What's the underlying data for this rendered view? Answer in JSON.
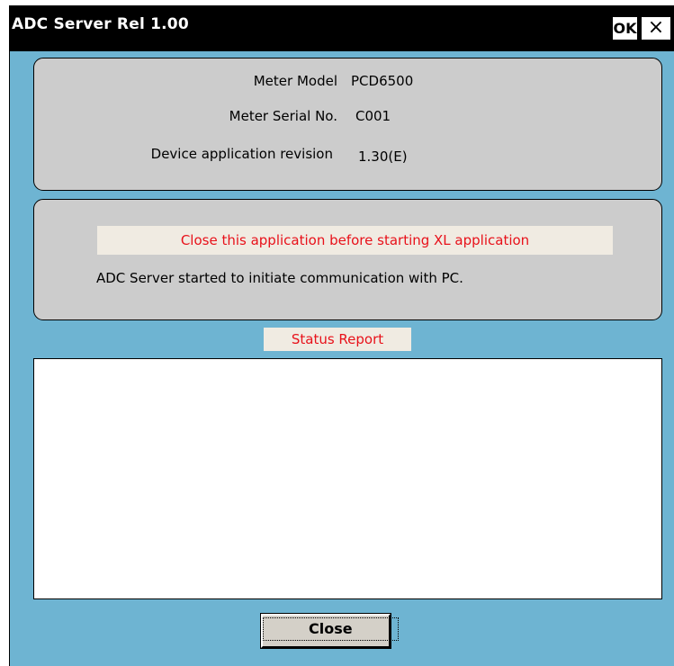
{
  "window": {
    "title": "ADC Server Rel 1.00",
    "ok_label": "OK",
    "close_icon": "×"
  },
  "info": {
    "meter_model_label": "Meter Model",
    "meter_model_value": "PCD6500",
    "serial_label": "Meter Serial No.",
    "serial_value": "C001",
    "revision_label": "Device application revision",
    "revision_value": "1.30(E)"
  },
  "message": {
    "warning": "Close this application before starting XL application",
    "status_text": "ADC Server started to initiate communication with PC."
  },
  "status": {
    "label": "Status Report",
    "report_text": ""
  },
  "buttons": {
    "close_label": "Close"
  },
  "colors": {
    "background": "#6eb4d2",
    "panel": "#cccccc",
    "warning_text": "#e8111a",
    "label_bg": "#f0ebe2"
  }
}
